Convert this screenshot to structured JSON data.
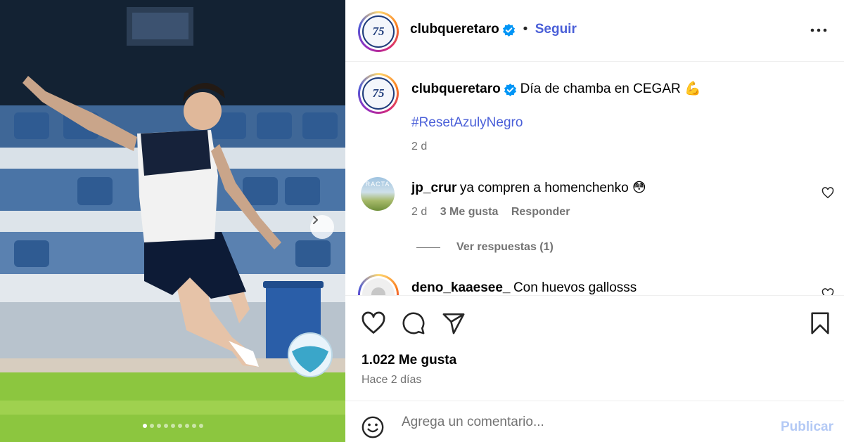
{
  "post": {
    "media_alt": "Futbolista pateando un balón en el entrenamiento",
    "carousel_total": 9,
    "carousel_active": 1
  },
  "header": {
    "username": "clubqueretaro",
    "separator": "•",
    "follow_label": "Seguir",
    "avatar_text": "75"
  },
  "caption": {
    "username": "clubqueretaro",
    "text": "Día de chamba en CEGAR 💪",
    "hashtag": "#ResetAzulyNegro",
    "time": "2 d"
  },
  "comments": [
    {
      "username": "jp_crur",
      "text": "ya compren a homenchenko 😳",
      "time": "2 d",
      "likes_label": "3 Me gusta",
      "reply_label": "Responder",
      "avatar_text": "RACTA",
      "view_replies": "Ver respuestas (1)"
    },
    {
      "username": "deno_kaaesee_",
      "text": "Con huevos gallosss"
    }
  ],
  "footer": {
    "likes": "1.022 Me gusta",
    "time_ago": "Hace 2 días",
    "comment_placeholder": "Agrega un comentario...",
    "publish_label": "Publicar"
  },
  "colors": {
    "accent": "#4a5fd8",
    "publish_disabled": "#b3c9f5",
    "secondary_text": "#737373",
    "verified": "#0095f6"
  }
}
